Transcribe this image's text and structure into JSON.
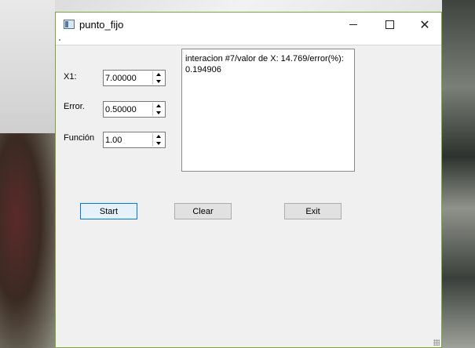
{
  "window": {
    "title": "punto_fijo",
    "min_glyph": "",
    "close_glyph": "✕"
  },
  "form": {
    "x1_label": "X1:",
    "x1_value": "7.00000",
    "error_label": "Error.",
    "error_value": "0.50000",
    "funcion_label": "Función",
    "funcion_value": "1.00"
  },
  "output_text": "interacion #7/valor de X: 14.769/error(%): 0.194906",
  "buttons": {
    "start": "Start",
    "clear": "Clear",
    "exit": "Exit"
  }
}
